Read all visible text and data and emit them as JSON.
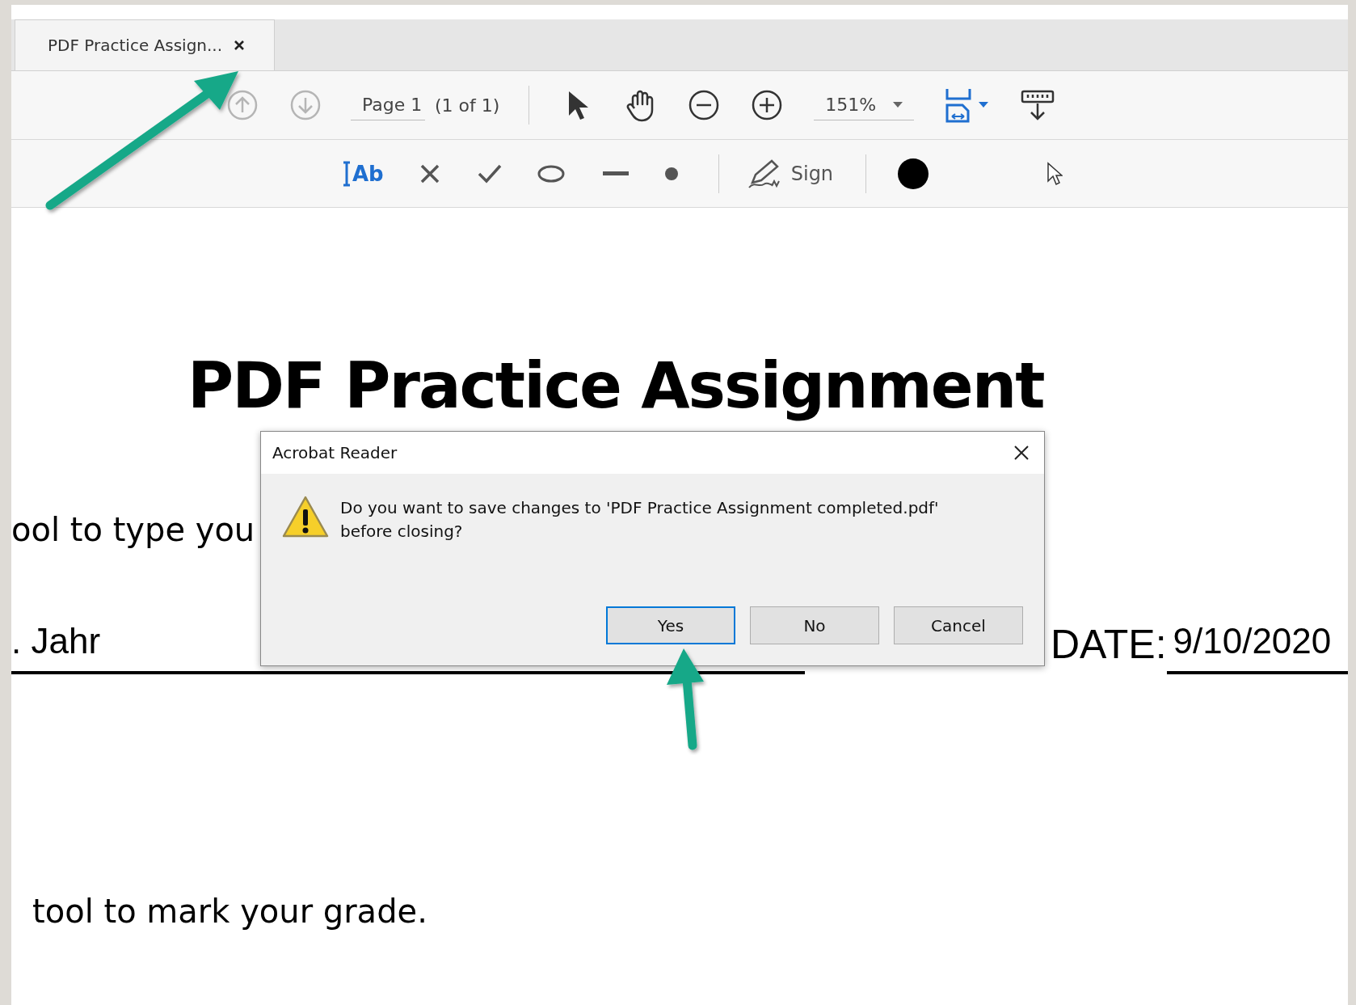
{
  "tab": {
    "title": "PDF Practice Assign...",
    "selected": true
  },
  "toolbar": {
    "page_field": {
      "value": "Page 1"
    },
    "page_count": "(1 of 1)",
    "zoom_field": {
      "value": "151%"
    }
  },
  "annotation_toolbar": {
    "text_tool_label": "Ab",
    "sign_label": "Sign"
  },
  "document": {
    "title": "PDF Practice Assignment",
    "line_1": "ool to type you",
    "name_value": ". Jahr",
    "date_label": "DATE:",
    "date_value": "9/10/2020",
    "line_2": "tool to mark your grade."
  },
  "dialog": {
    "title": "Acrobat Reader",
    "message": "Do you want to save changes to 'PDF Practice Assignment completed.pdf' before closing?",
    "buttons": [
      {
        "label": "Yes",
        "selected": true
      },
      {
        "label": "No",
        "selected": false
      },
      {
        "label": "Cancel",
        "selected": false
      }
    ]
  }
}
